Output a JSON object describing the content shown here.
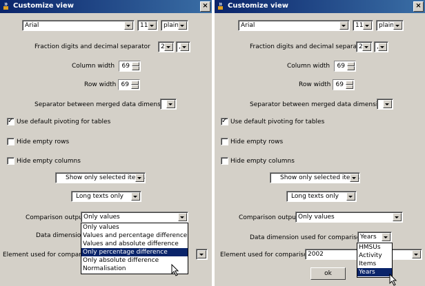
{
  "left": {
    "title": "Customize view",
    "font": {
      "family": "Arial",
      "size": "11",
      "style": "plain"
    },
    "fraction_label": "Fraction digits and decimal separator",
    "fraction_digits": "2",
    "decimal_separator": ",",
    "column_width_label": "Column width",
    "column_width": "69",
    "row_width_label": "Row width",
    "row_width": "69",
    "separator_label": "Separator between merged data dimensions",
    "default_pivot_label": "Use default pivoting for tables",
    "default_pivot_checked": true,
    "hide_rows_label": "Hide empty rows",
    "hide_cols_label": "Hide empty columns",
    "show_selected": "Show only selected items",
    "long_texts": "Long texts only",
    "comparison_label": "Comparison output",
    "comparison_value": "Only values",
    "data_dim_label": "Data dimension u",
    "element_label": "Element used for comparis",
    "comparison_options": [
      "Only values",
      "Values and percentage difference",
      "Values and absolute difference",
      "Only percentage difference",
      "Only absolute difference",
      "Normalisation"
    ],
    "comparison_selected_index": 3
  },
  "right": {
    "title": "Customize view",
    "font": {
      "family": "Arial",
      "size": "11",
      "style": "plain"
    },
    "fraction_label": "Fraction digits and decimal separator",
    "fraction_digits": "2",
    "decimal_separator": ",",
    "column_width_label": "Column width",
    "column_width": "69",
    "row_width_label": "Row width",
    "row_width": "69",
    "separator_label": "Separator between merged data dimensions",
    "default_pivot_label": "Use default pivoting for tables",
    "default_pivot_checked": true,
    "hide_rows_label": "Hide empty rows",
    "hide_cols_label": "Hide empty columns",
    "show_selected": "Show only selected items",
    "long_texts": "Long texts only",
    "comparison_label": "Comparison output",
    "comparison_value": "Only values",
    "data_dim_label": "Data dimension used for comparisons",
    "data_dim_value": "Years",
    "element_label": "Element used for comparisons",
    "element_value": "2002",
    "ok_label": "ok",
    "data_dim_options": [
      "HMSUs",
      "Activity",
      "Items",
      "Years"
    ],
    "data_dim_selected_index": 3
  },
  "icons": {
    "window": "java-cup-icon",
    "close": "close-icon",
    "cursor": "mouse-pointer-icon"
  }
}
